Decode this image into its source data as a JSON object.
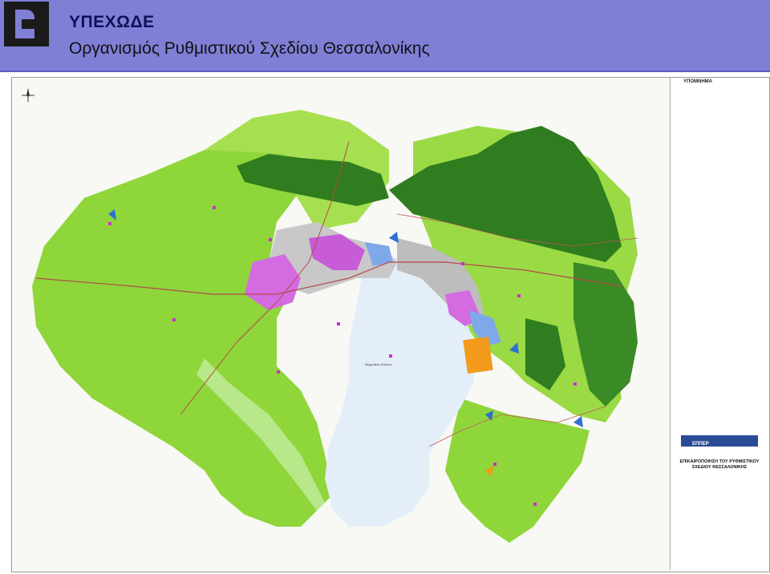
{
  "header": {
    "org_abbr": "ΥΠΕΧΩΔΕ",
    "org_name": "Οργανισμός Ρυθμιστικού Σχεδίου Θεσσαλονίκης"
  },
  "legend": {
    "title": "ΥΠΟΜΝΗΜΑ"
  },
  "title_block": {
    "firm": "ΕΠΠΕΡ",
    "project": "ΕΠΙΚΑΙΡΟΠΟΙΗΣΗ ΤΟΥ ΡΥΘΜΙΣΤΙΚΟΥ ΣΧΕΔΙΟΥ ΘΕΣΣΑΛΟΝΙΚΗΣ"
  },
  "map": {
    "sea_label": "Θερμαϊκός Κόλπος"
  },
  "colors": {
    "header_bg": "#7f7fd6",
    "agricultural": "#8fd63a",
    "forest": "#2f7d1e",
    "urban": "#c8c8c8",
    "industrial": "#d46be0",
    "sea": "#e3eef9",
    "airport": "#f39a1d",
    "commercial": "#7fa8e8"
  }
}
